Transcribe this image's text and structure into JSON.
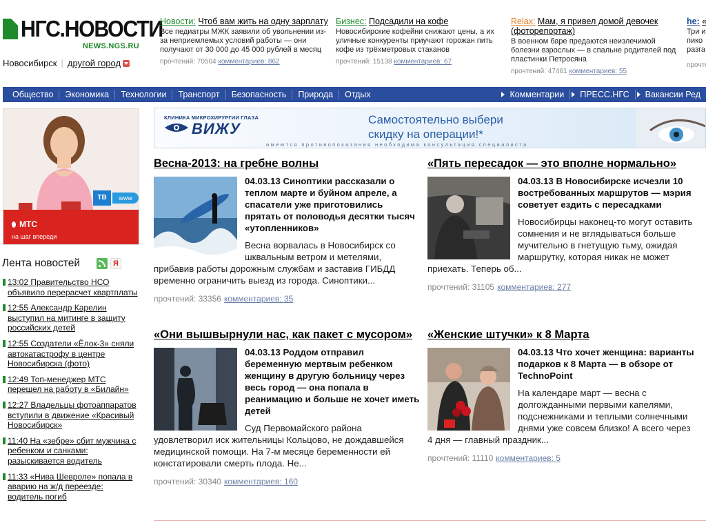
{
  "header": {
    "logo_text": "НГС.НОВОСТИ",
    "logo_sub": "NEWS.NGS.RU",
    "city": "Новосибирск",
    "other_city": "другой город"
  },
  "teasers": [
    {
      "rubric": "Новости:",
      "title": "Чтоб вам жить на одну зарплату",
      "text": "Все педиатры МЖК заявили об увольнении из-за неприемлемых условий работы — они получают от 30 000 до 45 000 рублей в месяц",
      "views": "прочтений: 70504",
      "comments": "комментариев: 862"
    },
    {
      "rubric": "Бизнес:",
      "title": "Подсадили на кофе",
      "text": "Новосибирские кофейни снижают цены, а их уличные конкуренты приучают горожан пить кофе из трёхметровых стаканов",
      "views": "прочтений: 15138",
      "comments": "комментариев: 67"
    },
    {
      "rubric": "Relax:",
      "title": "Мам, я привел домой девочек (фоторепортаж)",
      "text": "В военном баре предаются неизлечимой болезни взрослых — в спальне родителей под пластинки Петросяна",
      "views": "прочтений: 47461",
      "comments": "комментариев: 55"
    },
    {
      "rubric": "he:",
      "title": "«",
      "text": "Три и пико разга",
      "views": "прочте",
      "comments": ""
    }
  ],
  "colors": {
    "news": "#1f8a2a",
    "business": "#1f8a2a",
    "relax": "#e07b1a",
    "he": "#1b4f9c",
    "nav_bg": "#2b4d9e"
  },
  "nav": {
    "items": [
      "Общество",
      "Экономика",
      "Технологии",
      "Транспорт",
      "Безопасность",
      "Природа",
      "Отдых"
    ],
    "right": [
      "Комментарии",
      "ПРЕСС.НГС",
      "Вакансии Ред"
    ]
  },
  "ad_left": {
    "operator": "МТС",
    "slogan": "на шаг впереди",
    "tv": "ТВ",
    "www": "www"
  },
  "feed": {
    "title": "Лента новостей",
    "items": [
      "13:02 Правительство НСО объявило перерасчет квартплаты",
      "12:55 Александр Карелин выступил на митинге в защиту российских детей",
      "12:55 Создатели «Ёлок-3» сняли автокатастрофу в центре Новосибирска (фото)",
      "12:49 Топ-менеджер МТС перешел на работу в «Билайн»",
      "12:27 Владельцы фотоаппаратов вступили в движение «Красивый Новосибирск»",
      "11:40 На «зебре» сбит мужчина с ребенком и санками: разыскивается водитель",
      "11:33 «Нива Шевроле» попала в аварию на ж/д переезде: водитель погиб"
    ]
  },
  "banner": {
    "clinic": "КЛИНИКА МИКРОХИРУРГИИ ГЛАЗА",
    "brand": "ВИЖУ",
    "slogan_1": "Самостоятельно выбери",
    "slogan_2": "скидку на операции!*",
    "note": "имеются противопоказания необходима консультация специалиста"
  },
  "articles": [
    {
      "title": "Весна-2013: на гребне волны",
      "lead": "04.03.13 Синоптики рассказали о теплом марте и буйном апреле, а спасатели уже приготовились прятать от половодья десятки тысяч «утопленников»",
      "text": "Весна ворвалась в Новосибирск со шквальным ветром и метелями, прибавив работы дорожным службам и заставив ГИБДД временно ограничить выезд из города. Синоптики...",
      "views": "прочтений: 33356",
      "comments": "комментариев: 35"
    },
    {
      "title": "«Пять пересадок — это вполне нормально»",
      "lead": "04.03.13 В Новосибирске исчезли 10 востребованных маршрутов — мэрия советует ездить с пересадками",
      "text": "Новосибирцы наконец-то могут оставить сомнения и не вглядываться больше мучительно в гнетущую тьму, ожидая маршрутку, которая никак не может приехать. Теперь об...",
      "views": "прочтений: 31105",
      "comments": "комментариев: 277"
    },
    {
      "title": "«Они вышвырнули нас, как пакет с мусором»",
      "lead": "04.03.13 Роддом отправил беременную мертвым ребенком женщину в другую больницу через весь город — она попала в реанимацию и больше не хочет иметь детей",
      "text": "Суд Первомайского района удовлетворил иск жительницы Кольцово, не дождавшейся медицинской помощи. На 7-м месяце беременности ей констатировали смерть плода. Не...",
      "views": "прочтений: 30340",
      "comments": "комментариев: 160"
    },
    {
      "title": "«Женские штучки» к 8 Марта",
      "lead": "04.03.13 Что хочет женщина: варианты подарков к 8 Марта — в обзоре от TechnoPoint",
      "text": "На календаре март — весна с долгожданными первыми капелями, подснежниками и теплыми солнечными днями уже совсем близко! А всего через 4 дня — главный праздник...",
      "views": "прочтений: 11110",
      "comments": "комментариев: 5"
    }
  ]
}
